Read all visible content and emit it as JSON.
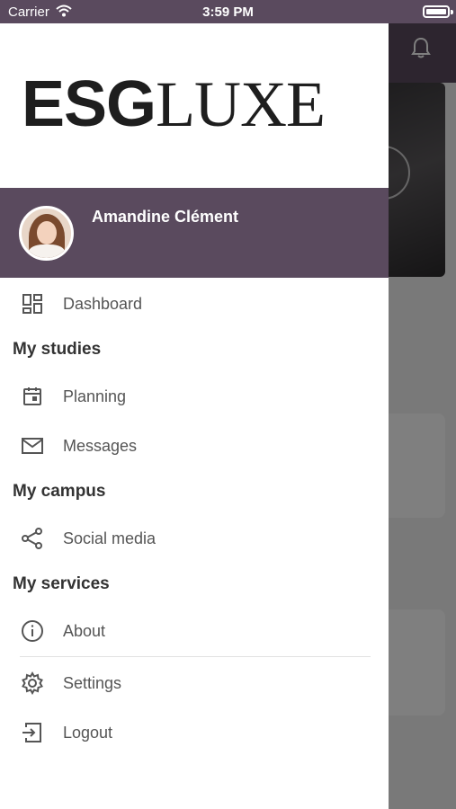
{
  "status": {
    "carrier": "Carrier",
    "time": "3:59 PM"
  },
  "brand": {
    "logo_part1": "ESG",
    "logo_part2": "LUXE"
  },
  "profile": {
    "name": "Amandine Clément"
  },
  "menu": {
    "dashboard": "Dashboard",
    "sections": {
      "studies": "My studies",
      "campus": "My campus",
      "services": "My services"
    },
    "planning": "Planning",
    "messages": "Messages",
    "social": "Social media",
    "about": "About",
    "settings": "Settings",
    "logout": "Logout"
  },
  "colors": {
    "accent": "#5a4a5e",
    "text": "#555555",
    "section": "#333333"
  },
  "icons": {
    "dashboard": "dashboard-icon",
    "planning": "calendar-icon",
    "messages": "mail-icon",
    "social": "share-icon",
    "about": "info-icon",
    "settings": "gear-icon",
    "logout": "logout-icon",
    "bell": "bell-icon"
  }
}
